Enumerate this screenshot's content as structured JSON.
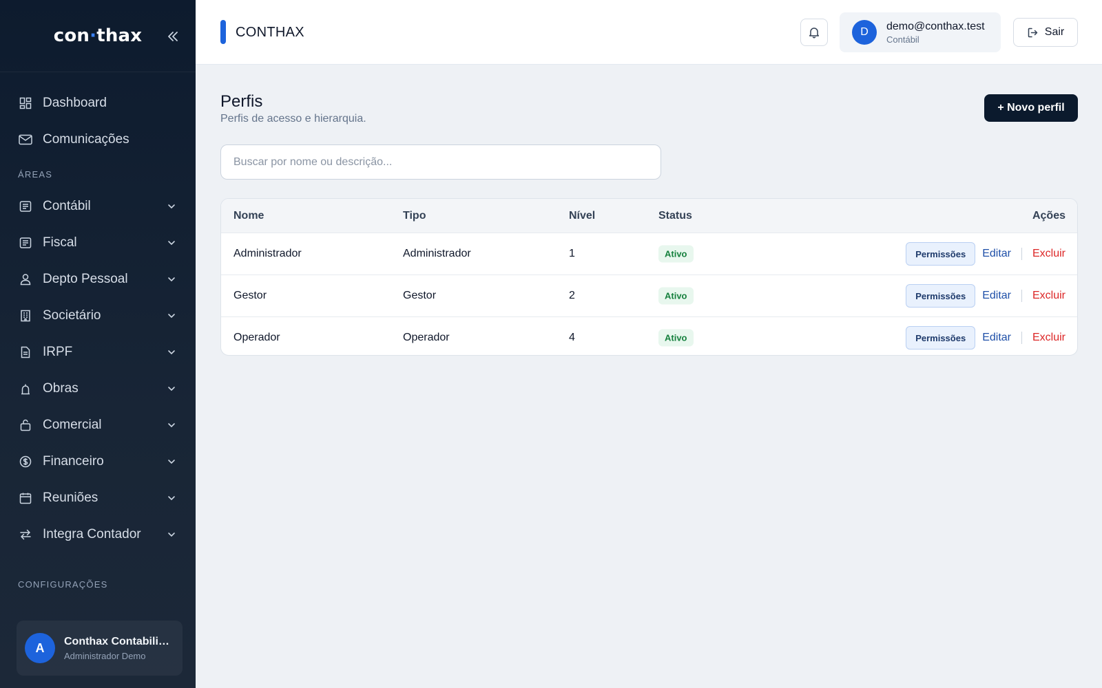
{
  "sidebar": {
    "logo_left": "con",
    "logo_dot": "·",
    "logo_right": "thax",
    "top_items": [
      {
        "label": "Dashboard",
        "icon": "dashboard-icon"
      },
      {
        "label": "Comunicações",
        "icon": "mail-icon"
      }
    ],
    "areas_label": "ÁREAS",
    "area_items": [
      {
        "label": "Contábil",
        "icon": "ledger-icon"
      },
      {
        "label": "Fiscal",
        "icon": "ledger-icon"
      },
      {
        "label": "Depto Pessoal",
        "icon": "person-icon"
      },
      {
        "label": "Societário",
        "icon": "building-icon"
      },
      {
        "label": "IRPF",
        "icon": "document-icon"
      },
      {
        "label": "Obras",
        "icon": "construction-icon"
      },
      {
        "label": "Comercial",
        "icon": "bag-icon"
      },
      {
        "label": "Financeiro",
        "icon": "money-icon"
      },
      {
        "label": "Reuniões",
        "icon": "calendar-icon"
      },
      {
        "label": "Integra Contador",
        "icon": "arrows-icon"
      }
    ],
    "config_label": "CONFIGURAÇÕES",
    "user": {
      "initial": "A",
      "name": "Conthax Contabilidade",
      "role": "Administrador Demo"
    }
  },
  "topbar": {
    "brand": "CONTHAX",
    "user_initial": "D",
    "user_email": "demo@conthax.test",
    "user_role": "Contábil",
    "logout_label": "Sair"
  },
  "page": {
    "title": "Perfis",
    "subtitle": "Perfis de acesso e hierarquia.",
    "new_button": "+ Novo perfil",
    "search_placeholder": "Buscar por nome ou descrição..."
  },
  "table": {
    "headers": {
      "nome": "Nome",
      "tipo": "Tipo",
      "nivel": "Nível",
      "status": "Status",
      "acoes": "Ações"
    },
    "rows": [
      {
        "nome": "Administrador",
        "tipo": "Administrador",
        "nivel": "1",
        "status": "Ativo"
      },
      {
        "nome": "Gestor",
        "tipo": "Gestor",
        "nivel": "2",
        "status": "Ativo"
      },
      {
        "nome": "Operador",
        "tipo": "Operador",
        "nivel": "4",
        "status": "Ativo"
      }
    ],
    "actions": {
      "permissions": "Permissões",
      "edit": "Editar",
      "delete": "Excluir"
    }
  },
  "colors": {
    "accent": "#1d63dc",
    "sidebar_bg": "#0d1b2e",
    "danger": "#dc2626",
    "success": "#15803d"
  }
}
